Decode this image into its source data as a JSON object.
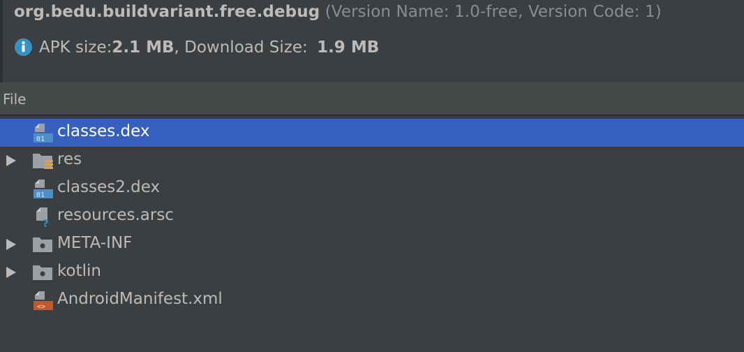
{
  "header": {
    "package_name": "org.bedu.buildvariant.free.debug",
    "version_info": " (Version Name: 1.0-free, Version Code: 1)",
    "apk_size_label": "APK size: ",
    "apk_size_value": "2.1 MB",
    "download_size_label": ", Download Size: ",
    "download_size_value": "1.9 MB"
  },
  "table": {
    "column_header": "File"
  },
  "tree": {
    "items": [
      {
        "label": "classes.dex",
        "icon": "dex-file-icon",
        "expandable": false,
        "selected": true
      },
      {
        "label": "res",
        "icon": "resource-folder-icon",
        "expandable": true,
        "selected": false
      },
      {
        "label": "classes2.dex",
        "icon": "dex-file-icon",
        "expandable": false,
        "selected": false
      },
      {
        "label": "resources.arsc",
        "icon": "unknown-file-icon",
        "expandable": false,
        "selected": false
      },
      {
        "label": "META-INF",
        "icon": "folder-icon",
        "expandable": true,
        "selected": false
      },
      {
        "label": "kotlin",
        "icon": "folder-icon",
        "expandable": true,
        "selected": false
      },
      {
        "label": "AndroidManifest.xml",
        "icon": "xml-file-icon",
        "expandable": false,
        "selected": false
      }
    ]
  },
  "colors": {
    "background": "#3c3f41",
    "selection": "#375fbe",
    "header_bar": "#45494a",
    "info_blue": "#3592c4",
    "dex_blue": "#4d8fc6",
    "xml_orange": "#c0592b",
    "res_yellow": "#d9a441"
  }
}
